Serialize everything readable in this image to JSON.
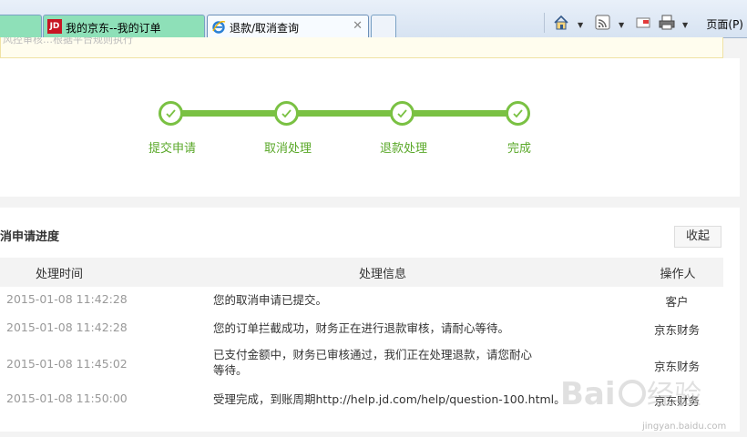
{
  "tabs": [
    {
      "label": ""
    },
    {
      "label": "我的京东--我的订单",
      "icon": "jd-logo"
    },
    {
      "label": "退款/取消查询",
      "icon": "ie-icon",
      "active": true
    },
    {
      "label": ""
    }
  ],
  "toolbar": {
    "page_label": "页面(P)"
  },
  "notice": {
    "text": "风控审核…根据平台规则执行"
  },
  "steps": [
    "提交申请",
    "取消处理",
    "退款处理",
    "完成"
  ],
  "progress_color": "#7ac143",
  "record": {
    "title": "消申请进度",
    "collapse_label": "收起",
    "columns": [
      "处理时间",
      "处理信息",
      "操作人"
    ],
    "rows": [
      {
        "time": "2015-01-08 11:42:28",
        "info": "您的取消申请已提交。",
        "operator": "客户"
      },
      {
        "time": "2015-01-08 11:42:28",
        "info": "您的订单拦截成功，财务正在进行退款审核，请耐心等待。",
        "operator": "京东财务"
      },
      {
        "time": "2015-01-08 11:45:02",
        "info": "已支付金额中，财务已审核通过，我们正在处理退款，请您耐心等待。",
        "operator": "京东财务"
      },
      {
        "time": "2015-01-08 11:50:00",
        "info": "受理完成，到账周期http://help.jd.com/help/question-100.html。",
        "operator": "京东财务"
      }
    ]
  },
  "watermark": {
    "brand": "Baidu经验",
    "url": "jingyan.baidu.com"
  }
}
